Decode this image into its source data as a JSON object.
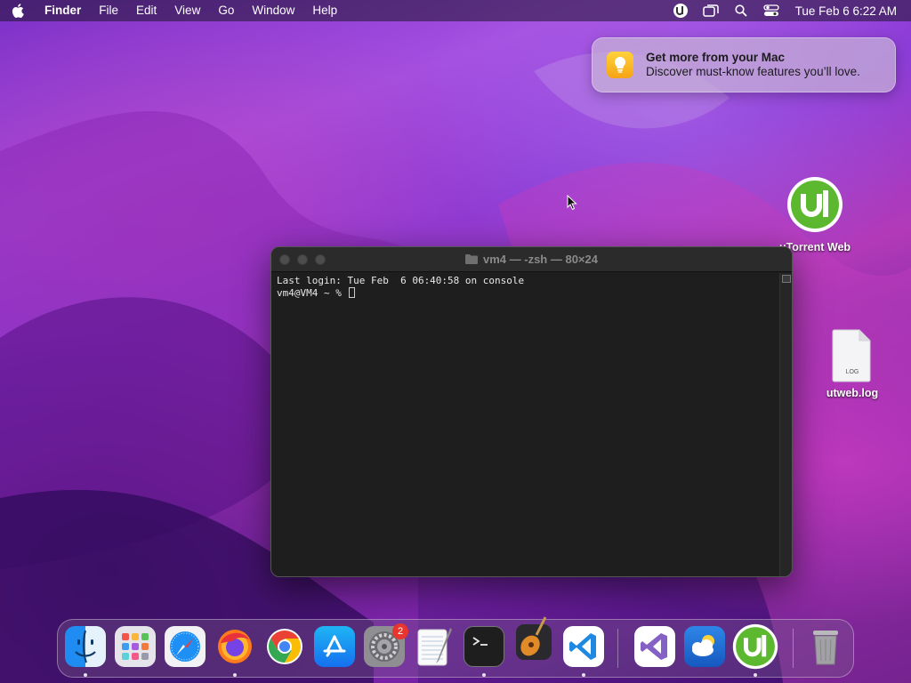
{
  "menubar": {
    "app_name": "Finder",
    "menus": [
      "File",
      "Edit",
      "View",
      "Go",
      "Window",
      "Help"
    ],
    "clock": "Tue Feb 6  6:22 AM",
    "status_icons": [
      "utorrent-icon",
      "screen-mirroring-icon",
      "spotlight-search-icon",
      "control-center-icon"
    ]
  },
  "notification": {
    "title": "Get more from your Mac",
    "body": "Discover must-know features you’ll love.",
    "icon": "lightbulb-icon"
  },
  "desktop": {
    "icons": [
      {
        "label": "uTorrent Web",
        "icon": "utorrent-icon"
      },
      {
        "label": "utweb.log",
        "icon": "log-file-icon",
        "file_badge": "LOG"
      }
    ]
  },
  "terminal": {
    "title": "vm4 — -zsh — 80×24",
    "lines": [
      "Last login: Tue Feb  6 06:40:58 on console",
      "vm4@VM4 ~ % "
    ]
  },
  "dock": {
    "items": [
      {
        "name": "Finder",
        "icon": "finder-icon",
        "running": true
      },
      {
        "name": "Launchpad",
        "icon": "launchpad-icon",
        "running": false
      },
      {
        "name": "Safari",
        "icon": "safari-icon",
        "running": false
      },
      {
        "name": "Firefox",
        "icon": "firefox-icon",
        "running": true
      },
      {
        "name": "Google Chrome",
        "icon": "chrome-icon",
        "running": false
      },
      {
        "name": "App Store",
        "icon": "app-store-icon",
        "running": false
      },
      {
        "name": "System Preferences",
        "icon": "system-preferences-icon",
        "running": false,
        "badge": "2"
      },
      {
        "name": "TextEdit",
        "icon": "textedit-icon",
        "running": false
      },
      {
        "name": "Terminal",
        "icon": "terminal-icon",
        "running": true
      },
      {
        "name": "GarageBand",
        "icon": "garageband-icon",
        "running": false
      },
      {
        "name": "Visual Studio Code",
        "icon": "vscode-icon",
        "running": true
      },
      {
        "name": "Visual Studio",
        "icon": "visual-studio-icon",
        "running": false
      },
      {
        "name": "Weather",
        "icon": "weather-icon",
        "running": false
      },
      {
        "name": "uTorrent Web",
        "icon": "utorrent-icon",
        "running": true
      },
      {
        "name": "Trash",
        "icon": "trash-icon",
        "running": false
      }
    ]
  },
  "colors": {
    "accent_utorrent": "#5cb82e",
    "badge_red": "#e8352d",
    "terminal_bg": "#1e1e1e"
  }
}
